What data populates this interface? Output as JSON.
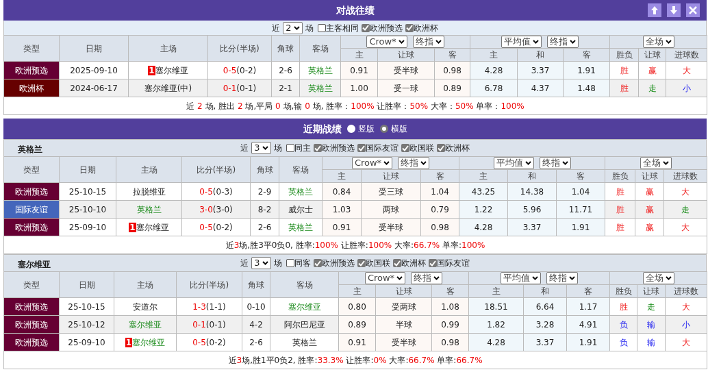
{
  "h2h": {
    "title": "对战往绩",
    "filter": {
      "prefix": "近",
      "count": "2",
      "suffix": "场",
      "options": [
        {
          "label": "主客相同",
          "checked": false
        },
        {
          "label": "欧洲预选",
          "checked": true
        },
        {
          "label": "欧洲杯",
          "checked": true
        }
      ]
    },
    "table": {
      "columns": [
        "类型",
        "日期",
        "主场",
        "比分(半场)",
        "角球",
        "客场"
      ],
      "odds_groups": [
        {
          "selects": [
            "Crow*",
            "终指"
          ],
          "columns": [
            "主",
            "让球",
            "客"
          ]
        },
        {
          "selects": [
            "平均值",
            "终指"
          ],
          "columns": [
            "主",
            "和",
            "客"
          ]
        },
        {
          "selects": [
            "全场"
          ],
          "columns": [
            "胜负",
            "让球",
            "进球数"
          ]
        }
      ],
      "rows": [
        {
          "type": {
            "text": "欧洲预选",
            "color": "#660033"
          },
          "date": "2025-09-10",
          "home": {
            "name": "塞尔维亚",
            "rank": "1",
            "highlight": false
          },
          "score": "0-5",
          "half": "(0-2)",
          "corners": "2-6",
          "away": {
            "name": "英格兰",
            "highlight": true
          },
          "odds": [
            "0.91",
            "受半球",
            "0.98",
            "4.28",
            "3.37",
            "1.91"
          ],
          "results": [
            {
              "text": "胜",
              "kind": "win"
            },
            {
              "text": "赢",
              "kind": "win"
            },
            {
              "text": "大",
              "kind": "win"
            }
          ]
        },
        {
          "type": {
            "text": "欧洲杯",
            "color": "#660000"
          },
          "date": "2024-06-17",
          "home": {
            "name": "塞尔维亚(中)",
            "highlight": false
          },
          "score": "0-1",
          "half": "(0-1)",
          "corners": "2-1",
          "away": {
            "name": "英格兰",
            "highlight": true
          },
          "odds": [
            "1.00",
            "受一球",
            "0.89",
            "6.78",
            "4.37",
            "1.48"
          ],
          "results": [
            {
              "text": "胜",
              "kind": "win"
            },
            {
              "text": "走",
              "kind": "draw"
            },
            {
              "text": "小",
              "kind": "loss"
            }
          ]
        }
      ],
      "summary": [
        {
          "text": "近 ",
          "highlight": false
        },
        {
          "text": "2",
          "highlight": true
        },
        {
          "text": " 场, 胜出 ",
          "highlight": false
        },
        {
          "text": "2",
          "highlight": true
        },
        {
          "text": " 场,平局 ",
          "highlight": false
        },
        {
          "text": "0",
          "highlight": true
        },
        {
          "text": " 场,输 ",
          "highlight": false
        },
        {
          "text": "0",
          "highlight": true
        },
        {
          "text": " 场, 胜率：",
          "highlight": false
        },
        {
          "text": "100%",
          "highlight": true
        },
        {
          "text": " 让胜率：",
          "highlight": false
        },
        {
          "text": "50%",
          "highlight": true
        },
        {
          "text": " 大率：",
          "highlight": false
        },
        {
          "text": "50%",
          "highlight": true
        },
        {
          "text": " 单率：",
          "highlight": false
        },
        {
          "text": "100%",
          "highlight": true
        }
      ]
    }
  },
  "recent": {
    "title": "近期战绩",
    "layouts": [
      {
        "label": "竖版",
        "selected": false
      },
      {
        "label": "横版",
        "selected": true
      }
    ],
    "teams": [
      {
        "name": "英格兰",
        "filter": {
          "prefix": "近",
          "count": "3",
          "suffix": "场",
          "options": [
            {
              "label": "同主",
              "checked": false
            },
            {
              "label": "欧洲预选",
              "checked": true
            },
            {
              "label": "国际友谊",
              "checked": true
            },
            {
              "label": "欧国联",
              "checked": true
            },
            {
              "label": "欧洲杯",
              "checked": true
            }
          ]
        },
        "table": {
          "columns": [
            "类型",
            "日期",
            "主场",
            "比分(半场)",
            "角球",
            "客场"
          ],
          "odds_groups": [
            {
              "selects": [
                "Crow*",
                "终指"
              ],
              "columns": [
                "主",
                "让球",
                "客"
              ]
            },
            {
              "selects": [
                "平均值",
                "终指"
              ],
              "columns": [
                "主",
                "和",
                "客"
              ]
            },
            {
              "selects": [
                "全场"
              ],
              "columns": [
                "胜负",
                "让球",
                "进球数"
              ]
            }
          ],
          "rows": [
            {
              "type": {
                "text": "欧洲预选",
                "color": "#660033"
              },
              "date": "25-10-15",
              "home": {
                "name": "拉脱维亚",
                "highlight": false
              },
              "score": "0-5",
              "half": "(0-3)",
              "corners": "2-9",
              "away": {
                "name": "英格兰",
                "highlight": true
              },
              "odds": [
                "0.84",
                "受三球",
                "1.04",
                "43.25",
                "14.38",
                "1.04"
              ],
              "results": [
                {
                  "text": "胜",
                  "kind": "win"
                },
                {
                  "text": "赢",
                  "kind": "win"
                },
                {
                  "text": "大",
                  "kind": "win"
                }
              ]
            },
            {
              "type": {
                "text": "国际友谊",
                "color": "#4466bb"
              },
              "date": "25-10-10",
              "home": {
                "name": "英格兰",
                "highlight": true
              },
              "score": "3-0",
              "half": "(3-0)",
              "corners": "8-2",
              "away": {
                "name": "威尔士",
                "highlight": false
              },
              "odds": [
                "1.03",
                "两球",
                "0.79",
                "1.22",
                "5.96",
                "11.71"
              ],
              "results": [
                {
                  "text": "胜",
                  "kind": "win"
                },
                {
                  "text": "赢",
                  "kind": "win"
                },
                {
                  "text": "走",
                  "kind": "draw"
                }
              ]
            },
            {
              "type": {
                "text": "欧洲预选",
                "color": "#660033"
              },
              "date": "25-09-10",
              "home": {
                "name": "塞尔维亚",
                "rank": "1",
                "highlight": false
              },
              "score": "0-5",
              "half": "(0-2)",
              "corners": "2-6",
              "away": {
                "name": "英格兰",
                "highlight": true
              },
              "odds": [
                "0.91",
                "受半球",
                "0.98",
                "4.28",
                "3.37",
                "1.91"
              ],
              "results": [
                {
                  "text": "胜",
                  "kind": "win"
                },
                {
                  "text": "赢",
                  "kind": "win"
                },
                {
                  "text": "大",
                  "kind": "win"
                }
              ]
            }
          ],
          "summary": [
            {
              "text": "近",
              "highlight": false
            },
            {
              "text": "3",
              "highlight": true
            },
            {
              "text": "场,胜3平0负0, 胜率:",
              "highlight": false
            },
            {
              "text": "100%",
              "highlight": true
            },
            {
              "text": " 让胜率:",
              "highlight": false
            },
            {
              "text": "100%",
              "highlight": true
            },
            {
              "text": " 大率:",
              "highlight": false
            },
            {
              "text": "66.7%",
              "highlight": true
            },
            {
              "text": " 单率:",
              "highlight": false
            },
            {
              "text": "100%",
              "highlight": true
            }
          ]
        }
      },
      {
        "name": "塞尔维亚",
        "filter": {
          "prefix": "近",
          "count": "3",
          "suffix": "场",
          "options": [
            {
              "label": "同客",
              "checked": false
            },
            {
              "label": "欧洲预选",
              "checked": true
            },
            {
              "label": "欧国联",
              "checked": true
            },
            {
              "label": "欧洲杯",
              "checked": true
            },
            {
              "label": "国际友谊",
              "checked": true
            }
          ]
        },
        "table": {
          "columns": [
            "类型",
            "日期",
            "主场",
            "比分(半场)",
            "角球",
            "客场"
          ],
          "odds_groups": [
            {
              "selects": [
                "Crow*",
                "终指"
              ],
              "columns": [
                "主",
                "让球",
                "客"
              ]
            },
            {
              "selects": [
                "平均值",
                "终指"
              ],
              "columns": [
                "主",
                "和",
                "客"
              ]
            },
            {
              "selects": [
                "全场"
              ],
              "columns": [
                "胜负",
                "让球",
                "进球数"
              ]
            }
          ],
          "rows": [
            {
              "type": {
                "text": "欧洲预选",
                "color": "#660033"
              },
              "date": "25-10-15",
              "home": {
                "name": "安道尔",
                "highlight": false
              },
              "score": "1-3",
              "half": "(1-1)",
              "corners": "0-10",
              "away": {
                "name": "塞尔维亚",
                "highlight": true
              },
              "odds": [
                "0.80",
                "受两球",
                "1.08",
                "18.51",
                "6.64",
                "1.17"
              ],
              "results": [
                {
                  "text": "胜",
                  "kind": "win"
                },
                {
                  "text": "走",
                  "kind": "draw"
                },
                {
                  "text": "大",
                  "kind": "win"
                }
              ]
            },
            {
              "type": {
                "text": "欧洲预选",
                "color": "#660033"
              },
              "date": "25-10-12",
              "home": {
                "name": "塞尔维亚",
                "highlight": true
              },
              "score": "0-1",
              "half": "(0-1)",
              "corners": "4-2",
              "away": {
                "name": "阿尔巴尼亚",
                "highlight": false
              },
              "odds": [
                "0.89",
                "半球",
                "0.99",
                "1.82",
                "3.28",
                "4.91"
              ],
              "results": [
                {
                  "text": "负",
                  "kind": "loss"
                },
                {
                  "text": "输",
                  "kind": "loss"
                },
                {
                  "text": "小",
                  "kind": "loss"
                }
              ]
            },
            {
              "type": {
                "text": "欧洲预选",
                "color": "#660033"
              },
              "date": "25-09-10",
              "home": {
                "name": "塞尔维亚",
                "rank": "1",
                "highlight": true
              },
              "score": "0-5",
              "half": "(0-2)",
              "corners": "2-6",
              "away": {
                "name": "英格兰",
                "highlight": false
              },
              "odds": [
                "0.91",
                "受半球",
                "0.98",
                "4.28",
                "3.37",
                "1.91"
              ],
              "results": [
                {
                  "text": "负",
                  "kind": "loss"
                },
                {
                  "text": "输",
                  "kind": "loss"
                },
                {
                  "text": "大",
                  "kind": "win"
                }
              ]
            }
          ],
          "summary": [
            {
              "text": "近",
              "highlight": false
            },
            {
              "text": "3",
              "highlight": true
            },
            {
              "text": "场,胜1平0负2, 胜率:",
              "highlight": false
            },
            {
              "text": "33.3%",
              "highlight": true
            },
            {
              "text": " 让胜率:",
              "highlight": false
            },
            {
              "text": "0%",
              "highlight": true
            },
            {
              "text": " 大率:",
              "highlight": false
            },
            {
              "text": "66.7%",
              "highlight": true
            },
            {
              "text": " 单率:",
              "highlight": false
            },
            {
              "text": "66.7%",
              "highlight": true
            }
          ]
        }
      }
    ]
  }
}
